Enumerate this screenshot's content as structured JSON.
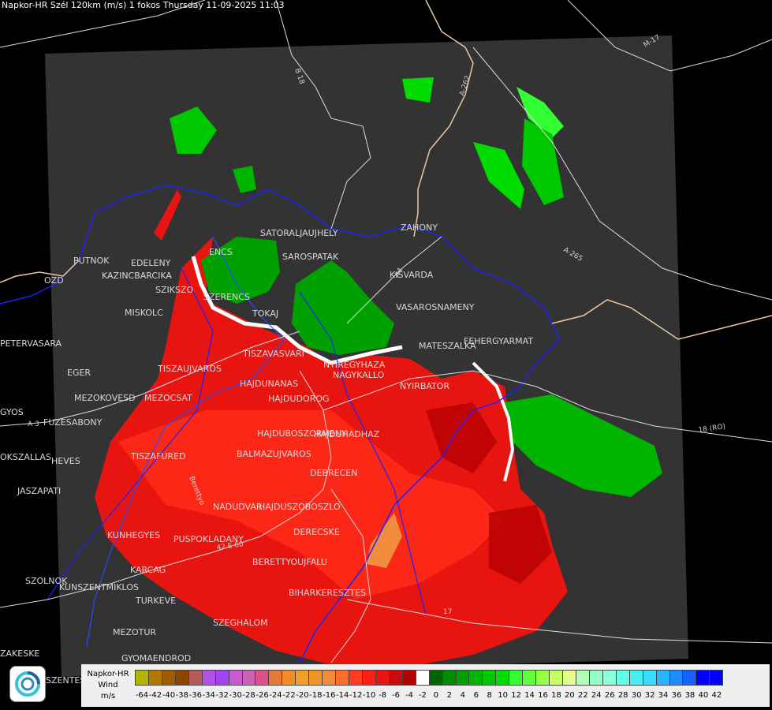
{
  "title": "Napkor-HR Szél 120km (m/s) 1 fokos Thursday 11-09-2025 11:03",
  "places": [
    {
      "name": "SATORALJAUJHELY"
    },
    {
      "name": "SAROSPATAK"
    },
    {
      "name": "PUTNOK"
    },
    {
      "name": "EDELENY"
    },
    {
      "name": "KAZINCBARCIKA"
    },
    {
      "name": "SZIKSZO"
    },
    {
      "name": "ENCS"
    },
    {
      "name": "SZERENCS"
    },
    {
      "name": "TOKAJ"
    },
    {
      "name": "MISKOLC"
    },
    {
      "name": "KISVARDA"
    },
    {
      "name": "VASAROSNAMENY"
    },
    {
      "name": "ZAHONY"
    },
    {
      "name": "MATESZALKA"
    },
    {
      "name": "FEHERGYARMAT"
    },
    {
      "name": "PETERVASARA"
    },
    {
      "name": "EGER"
    },
    {
      "name": "TISZAUJVAROS"
    },
    {
      "name": "TISZAVASVARI"
    },
    {
      "name": "NYIREGYHAZA"
    },
    {
      "name": "NAGYKALLO"
    },
    {
      "name": "NYIRBATOR"
    },
    {
      "name": "HAJDUNANAS"
    },
    {
      "name": "HAJDUDOROG"
    },
    {
      "name": "MEZOKOVESD"
    },
    {
      "name": "MEZOCSAT"
    },
    {
      "name": "GYOS"
    },
    {
      "name": "FUZESABONY"
    },
    {
      "name": "HAJDUBOSZORMENY"
    },
    {
      "name": "HAJDUHADHAZ"
    },
    {
      "name": "BALMAZUJVAROS"
    },
    {
      "name": "TISZAFURED"
    },
    {
      "name": "HEVES"
    },
    {
      "name": "DEBRECEN"
    },
    {
      "name": "JASZAPATI"
    },
    {
      "name": "NADUDVAR"
    },
    {
      "name": "HAJDUSZOBOSZLO"
    },
    {
      "name": "KUNHEGYES"
    },
    {
      "name": "PUSPOKLADANY"
    },
    {
      "name": "DERECSKE"
    },
    {
      "name": "BERETTYOUJFALU"
    },
    {
      "name": "KARCAG"
    },
    {
      "name": "KUNSZENTMIKLOS"
    },
    {
      "name": "TURKEVE"
    },
    {
      "name": "BIHARKERESZTES"
    },
    {
      "name": "SZOLNOK"
    },
    {
      "name": "SZEGHALOM"
    },
    {
      "name": "MEZOTUR"
    },
    {
      "name": "GYOMAENDROD"
    },
    {
      "name": "SZENTES"
    },
    {
      "name": "OKSZALLAS"
    },
    {
      "name": "ZAKESKE"
    },
    {
      "name": "OZD"
    }
  ],
  "roads": [
    {
      "name": "B 18"
    },
    {
      "name": "A-262"
    },
    {
      "name": "M-17"
    },
    {
      "name": "A-265"
    },
    {
      "name": "18 (RO)"
    },
    {
      "name": "A 3"
    },
    {
      "name": "A4"
    },
    {
      "name": "42 E 60"
    },
    {
      "name": "Berettyo"
    },
    {
      "name": "17"
    }
  ],
  "legend": {
    "title_lines": [
      "Napkor-HR",
      "Wind",
      "m/s"
    ],
    "labels": [
      "-64",
      "-42",
      "-40",
      "-38",
      "-36",
      "-34",
      "-32",
      "-30",
      "-28",
      "-26",
      "-24",
      "-22",
      "-20",
      "-18",
      "-16",
      "-14",
      "-12",
      "-10",
      "-8",
      "-6",
      "-4",
      "-2",
      "0",
      "2",
      "4",
      "6",
      "8",
      "10",
      "12",
      "14",
      "16",
      "18",
      "20",
      "22",
      "24",
      "26",
      "28",
      "30",
      "32",
      "34",
      "36",
      "38",
      "40",
      "42"
    ],
    "colors": [
      "#b4b400",
      "#b47800",
      "#a05a00",
      "#8c4600",
      "#b45a5a",
      "#b450e6",
      "#a046f0",
      "#c85ad2",
      "#c864b4",
      "#dc508c",
      "#e6783c",
      "#f08c28",
      "#f0a028",
      "#f09628",
      "#f08c3c",
      "#ff6e28",
      "#ff3c1e",
      "#ff1e14",
      "#e61414",
      "#c80a0a",
      "#b40000",
      "#ffffff",
      "#006400",
      "#008c00",
      "#00a000",
      "#00b400",
      "#00c800",
      "#00dc00",
      "#32ff32",
      "#64ff3c",
      "#96ff46",
      "#c8ff64",
      "#e6ff8c",
      "#b4ffb4",
      "#96ffc8",
      "#8cffdc",
      "#64ffe6",
      "#46f0f0",
      "#3cdcff",
      "#28b4ff",
      "#1e8cff",
      "#1464ff",
      "#0000ff",
      "#0000ff"
    ]
  },
  "colors": {
    "background": "#000000",
    "map_frame": "#333333",
    "borders": "#0000ff"
  }
}
